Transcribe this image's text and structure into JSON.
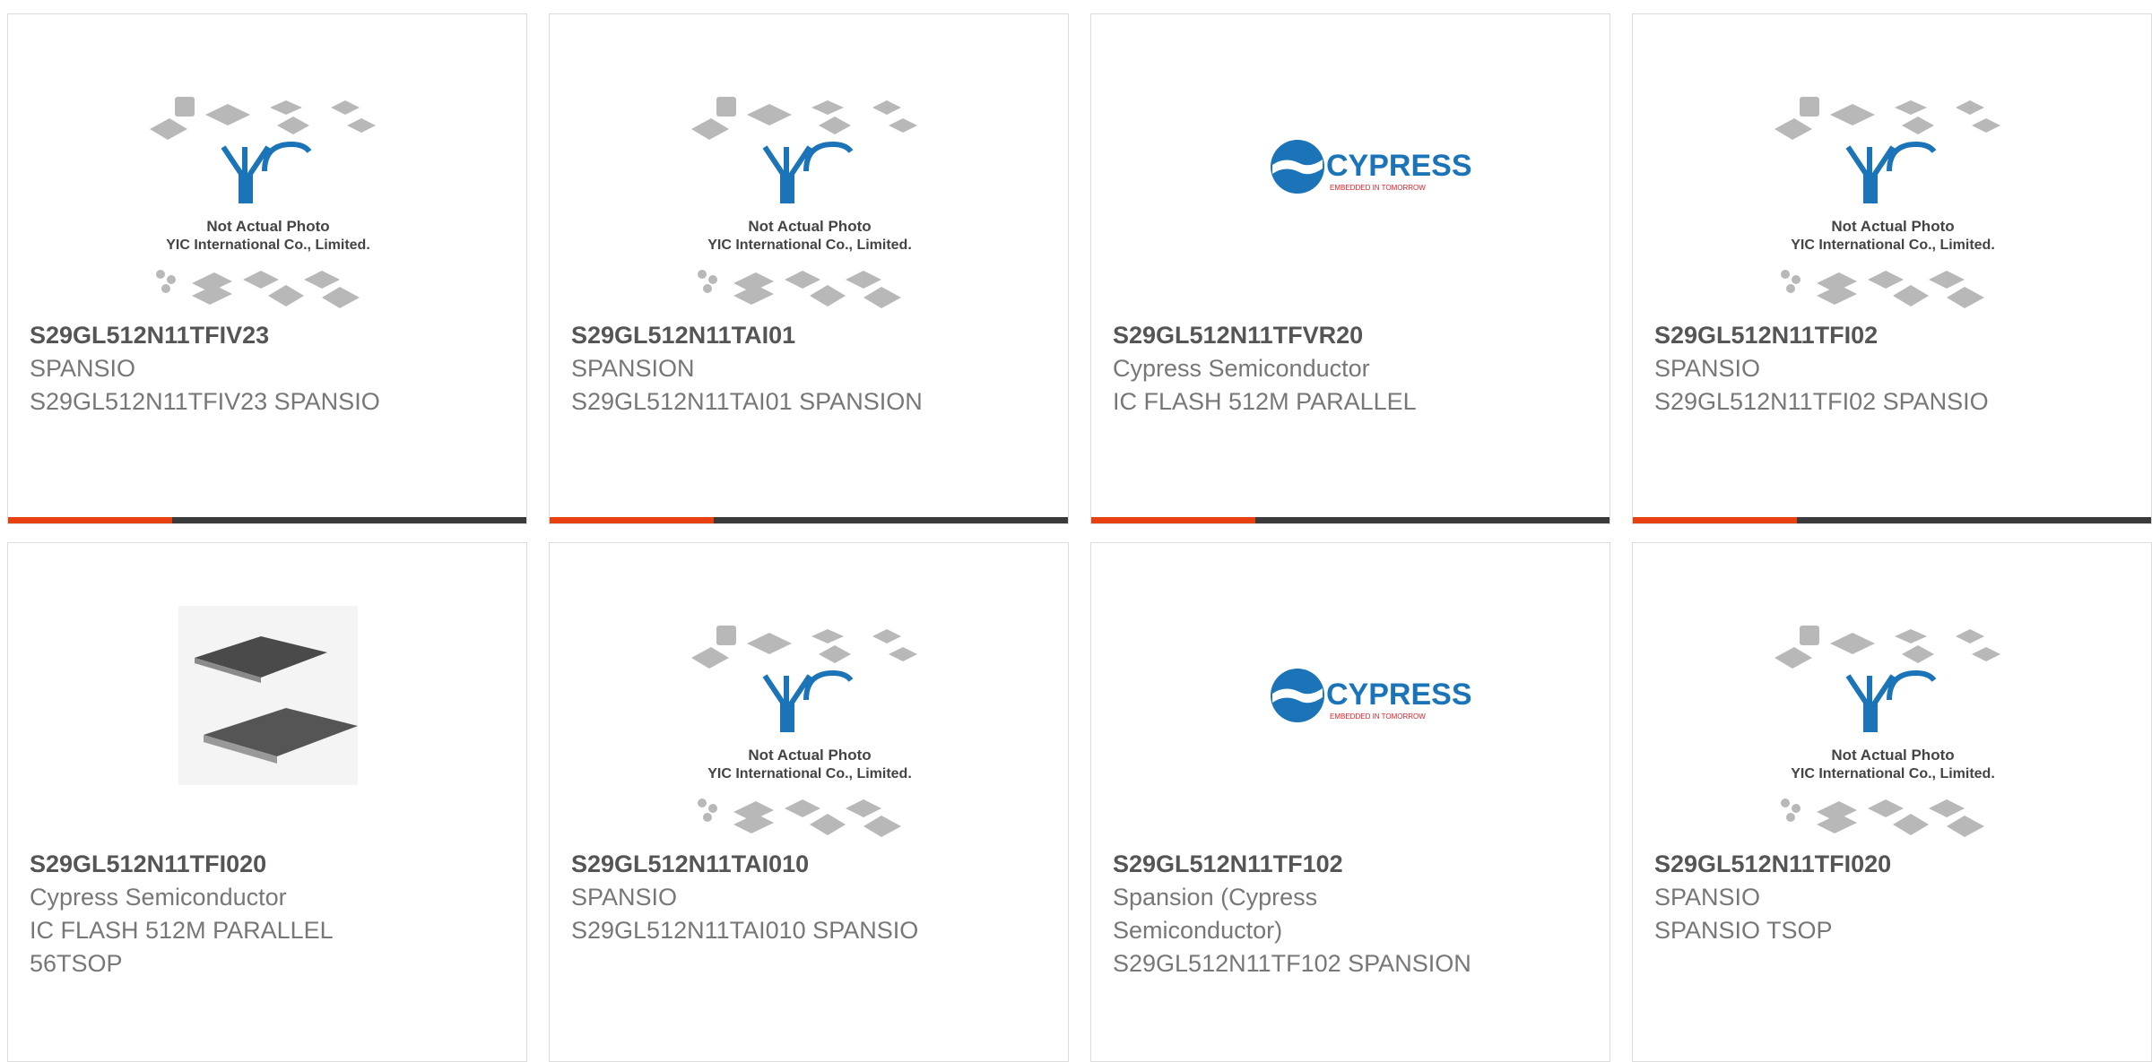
{
  "colors": {
    "accent": "#e8410f",
    "bar_dark": "#3a3a3a",
    "yic_blue": "#1b74b8",
    "cypress_red": "#e0212a"
  },
  "products": [
    {
      "part": "S29GL512N11TFIV23",
      "manufacturer": "SPANSIO",
      "description": "S29GL512N11TFIV23 SPANSIO",
      "image": "yic-placeholder"
    },
    {
      "part": "S29GL512N11TAI01",
      "manufacturer": "SPANSION",
      "description": "S29GL512N11TAI01 SPANSION",
      "image": "yic-placeholder"
    },
    {
      "part": "S29GL512N11TFVR20",
      "manufacturer": "Cypress Semiconductor",
      "description": "IC FLASH 512M PARALLEL",
      "image": "cypress-logo"
    },
    {
      "part": "S29GL512N11TFI02",
      "manufacturer": "SPANSIO",
      "description": "S29GL512N11TFI02 SPANSIO",
      "image": "yic-placeholder"
    },
    {
      "part": "S29GL512N11TFI020",
      "manufacturer": "Cypress Semiconductor",
      "description": "IC FLASH 512M PARALLEL 56TSOP",
      "image": "tsop-chip-photo"
    },
    {
      "part": "S29GL512N11TAI010",
      "manufacturer": "SPANSIO",
      "description": "S29GL512N11TAI010 SPANSIO",
      "image": "yic-placeholder"
    },
    {
      "part": "S29GL512N11TF102",
      "manufacturer": "Spansion (Cypress Semiconductor)",
      "description": "S29GL512N11TF102 SPANSION",
      "image": "cypress-logo"
    },
    {
      "part": "S29GL512N11TFI020",
      "manufacturer": "SPANSIO",
      "description": "SPANSIO TSOP",
      "image": "yic-placeholder"
    }
  ],
  "placeholder": {
    "line1": "Not Actual Photo",
    "line2": "YIC International Co., Limited.",
    "logo_text": "YIC"
  },
  "cypress": {
    "brand": "CYPRESS",
    "tagline": "EMBEDDED IN TOMORROW"
  }
}
